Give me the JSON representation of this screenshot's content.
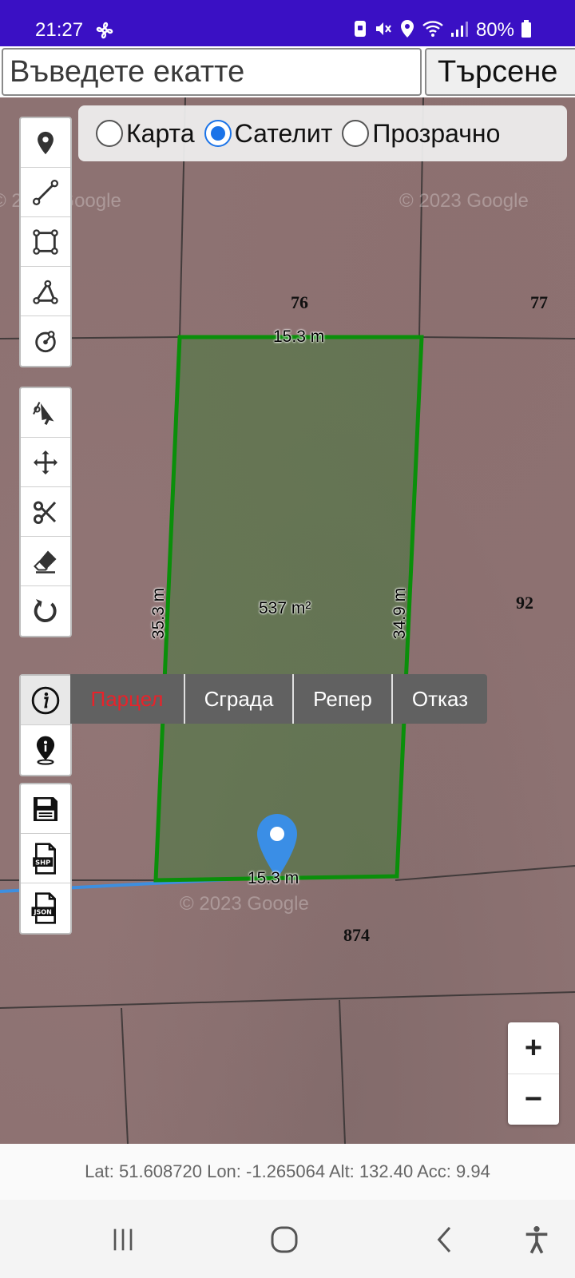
{
  "status_bar": {
    "time": "21:27",
    "battery": "80%"
  },
  "search": {
    "placeholder": "Въведете екатте",
    "value": "",
    "button_label": "Търсене"
  },
  "map_type": {
    "options": [
      {
        "label": "Карта",
        "checked": false
      },
      {
        "label": "Сателит",
        "checked": true
      },
      {
        "label": "Прозрачно",
        "checked": false
      }
    ]
  },
  "toolbar_draw": [
    "marker-icon",
    "polyline-icon",
    "rectangle-icon",
    "polygon-icon",
    "circle-icon"
  ],
  "toolbar_edit": [
    "edit-icon",
    "move-icon",
    "cut-icon",
    "eraser-icon",
    "rotate-icon"
  ],
  "toolbar_info": [
    "info-icon",
    "location-pin-icon"
  ],
  "toolbar_export": [
    "save-icon",
    "shp-file-icon",
    "json-file-icon"
  ],
  "attribute_menu": {
    "items": [
      {
        "label": "Парцел",
        "color": "#e8222a"
      },
      {
        "label": "Сграда",
        "color": "#ffffff"
      },
      {
        "label": "Репер",
        "color": "#ffffff"
      },
      {
        "label": "Отказ",
        "color": "#ffffff"
      }
    ]
  },
  "map": {
    "parcel_labels": [
      "76",
      "77",
      "92",
      "874"
    ],
    "measurements": {
      "top": "15.3 m",
      "bottom": "15.3 m",
      "left": "35.3 m",
      "right": "34.9 m",
      "area": "537 m²"
    },
    "watermark": "© 2023 Google",
    "polygon_color": "#0a8f0a",
    "track_color": "#3d8fe0",
    "marker_color": "#3a8ee6"
  },
  "zoom": {
    "in_label": "+",
    "out_label": "−"
  },
  "coordinates": {
    "text": "Lat: 51.608720 Lon: -1.265064 Alt: 132.40 Acc: 9.94"
  }
}
